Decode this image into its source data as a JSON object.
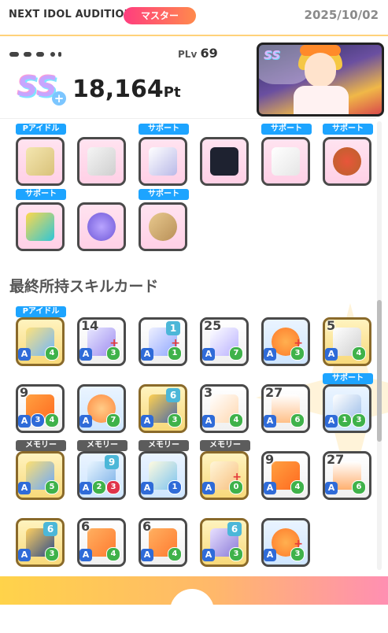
{
  "header": {
    "title": "NEXT IDOL AUDITION",
    "mode": "マスター",
    "date": "2025/10/02"
  },
  "score": {
    "plv_label": "PLv",
    "plv_value": "69",
    "rank": "SS",
    "rank_plus": "+",
    "points": "18,164",
    "unit": "Pt"
  },
  "portrait": {
    "badge": "SS"
  },
  "items_section": {
    "tags": [
      "Pアイドル",
      "サポート",
      "サポート",
      "サポート",
      "サポート",
      "サポート"
    ]
  },
  "skills_section": {
    "title": "最終所持スキルカード",
    "tags": [
      "Pアイドル",
      "サポート",
      "メモリー",
      "メモリー",
      "メモリー",
      "メモリー"
    ],
    "costs": {
      "r1c2": "14",
      "r1c3": "1",
      "r1c4": "25",
      "r1c6": "5",
      "r2c1": "9",
      "r2c3": "6",
      "r2c4": "3",
      "r2c5": "27",
      "r3c2": "9",
      "r3c5": "9",
      "r3c6": "27",
      "r4c1": "6",
      "r4c2": "6",
      "r4c3": "6",
      "r4c4": "6"
    },
    "green": {
      "r1c1": "4",
      "r1c2": "3",
      "r1c3": "1",
      "r1c4": "7",
      "r1c5": "3",
      "r1c6": "4",
      "r2c1": "4",
      "r2c2": "7",
      "r2c3": "3",
      "r2c4": "4",
      "r2c5": "6",
      "r2c6": "3",
      "r3c1": "5",
      "r3c2": "3",
      "r3c3": "1",
      "r3c4": "0",
      "r3c5": "4",
      "r3c6": "6",
      "r4c1": "3",
      "r4c2": "4",
      "r4c3": "4",
      "r4c4": "3",
      "r4c5": "3"
    },
    "extra": {
      "r2c1_blue": "3",
      "r2c6_green": "1",
      "r3c2_green": "2"
    }
  },
  "colors": {
    "accent_pink": "#ff3d7f",
    "accent_orange": "#ff8a4c",
    "tag_blue": "#1da4ff"
  }
}
